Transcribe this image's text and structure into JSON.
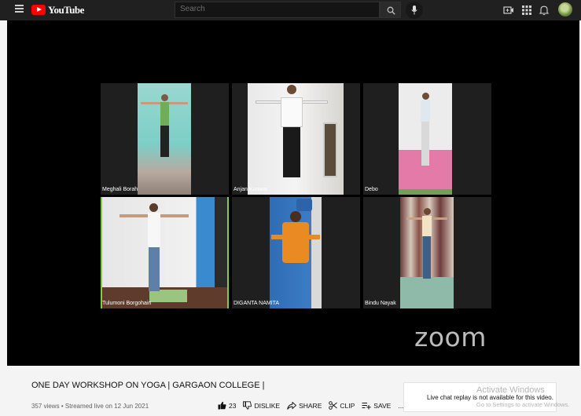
{
  "header": {
    "logo_text": "YouTube",
    "search_placeholder": "Search"
  },
  "video": {
    "participants": [
      "Meghali Borah",
      "Anjan Konwar",
      "Debo",
      "Tulumoni Borgohain",
      "DIGANTA NAMITA",
      "Bindu Nayak"
    ],
    "watermark": "zoom",
    "active_speaker_color": "#7bd23a"
  },
  "info": {
    "title": "ONE DAY WORKSHOP ON YOGA | GARGAON COLLEGE |",
    "views": "357 views",
    "streamed": "Streamed live on 12 Jun 2021",
    "separator": "•"
  },
  "actions": {
    "like_count": "23",
    "dislike": "DISLIKE",
    "share": "SHARE",
    "clip": "CLIP",
    "save": "SAVE",
    "more": "..."
  },
  "chat": {
    "message": "Live chat replay is not available for this video."
  },
  "overlay": {
    "activate_title": "Activate Windows",
    "activate_sub": "Go to Settings to activate Windows."
  },
  "colors": {
    "brand_red": "#ff0000",
    "topbar": "#202020"
  }
}
